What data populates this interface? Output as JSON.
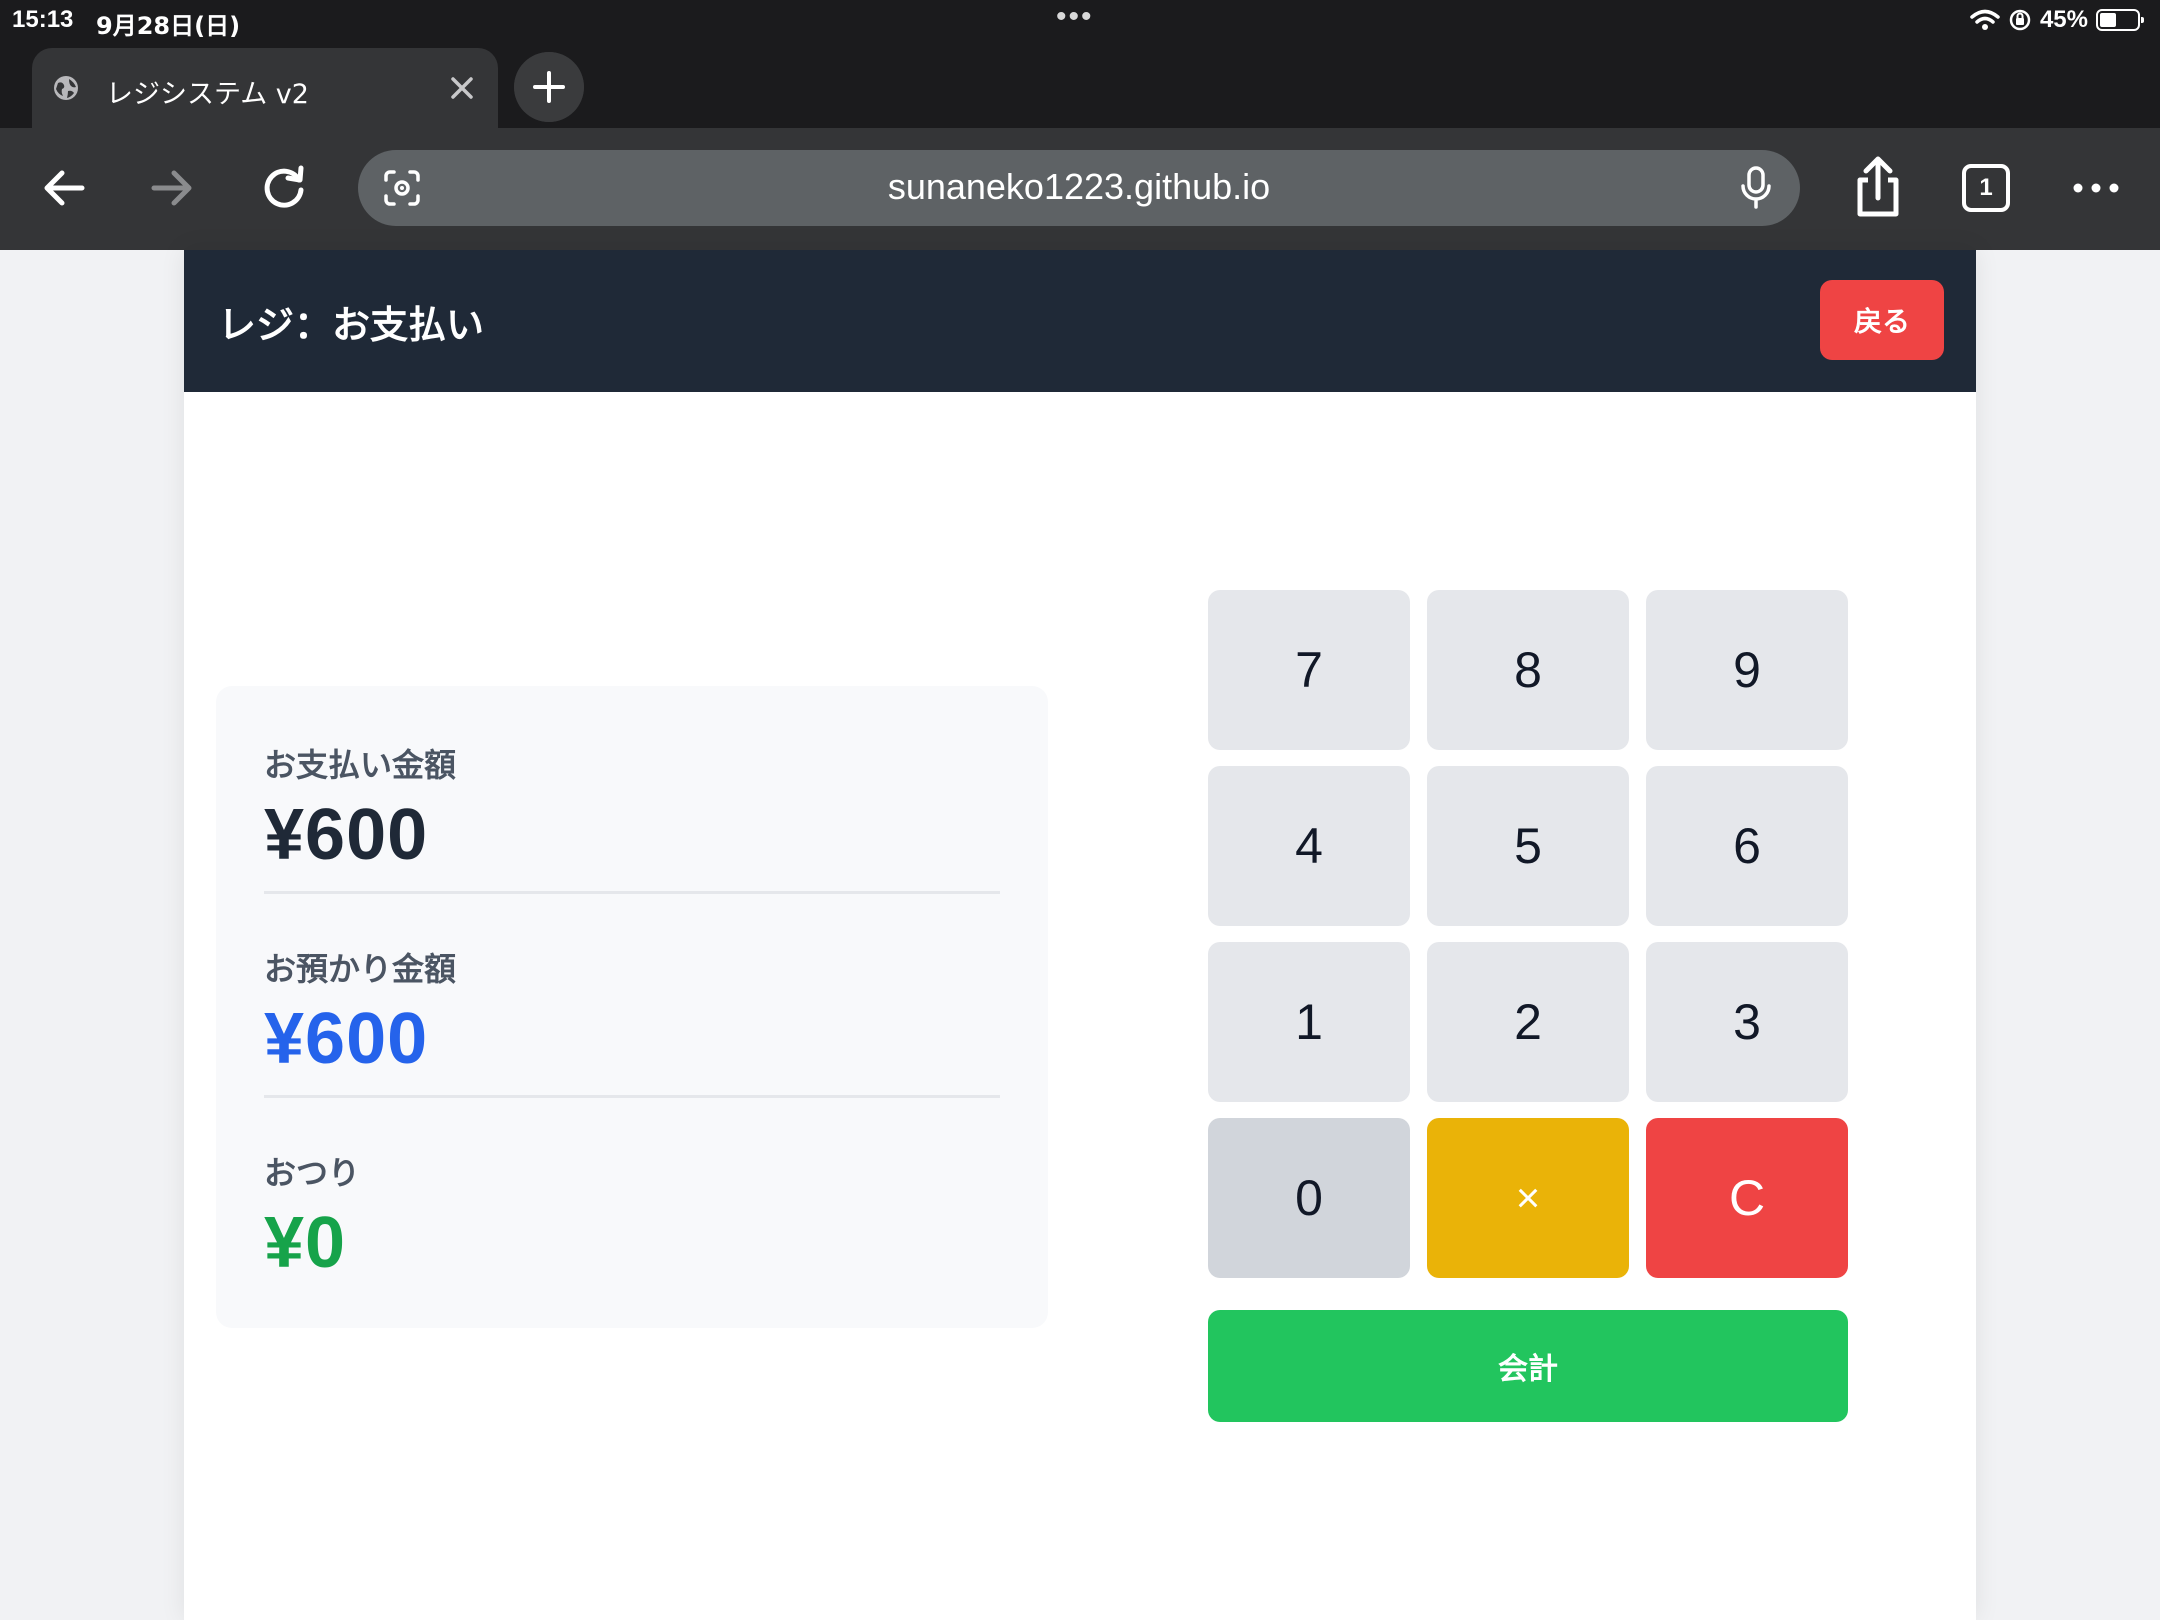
{
  "status_bar": {
    "time": "15:13",
    "date": "9月28日(日)",
    "battery": "45%",
    "battery_level": 0.45
  },
  "browser": {
    "tab_title": "レジシステム v2",
    "url": "sunaneko1223.github.io",
    "tab_count": "1"
  },
  "app": {
    "header_title": "レジ：お支払い",
    "back_label": "戻る"
  },
  "summary": {
    "payment_label": "お支払い金額",
    "payment_amount": "¥600",
    "received_label": "お預かり金額",
    "received_amount": "¥600",
    "change_label": "おつり",
    "change_amount": "¥0"
  },
  "keypad": {
    "keys": [
      "7",
      "8",
      "9",
      "4",
      "5",
      "6",
      "1",
      "2",
      "3",
      "0",
      "×",
      "C"
    ],
    "checkout_label": "会計"
  },
  "colors": {
    "header_bg": "#1f2937",
    "danger": "#ef4444",
    "warning": "#eab308",
    "success": "#22c55e",
    "payment_text": "#1f2937",
    "received_text": "#2563eb",
    "change_text": "#16a34a"
  },
  "icons": {
    "tab_favicon": "globe-icon",
    "tab_close": "close-icon",
    "new_tab": "plus-icon",
    "back": "arrow-left-icon",
    "forward": "arrow-right-icon",
    "reload": "reload-icon",
    "lens": "camera-search-icon",
    "mic": "microphone-icon",
    "share": "share-icon",
    "tabs": "tab-count-icon",
    "menu": "more-icon"
  }
}
